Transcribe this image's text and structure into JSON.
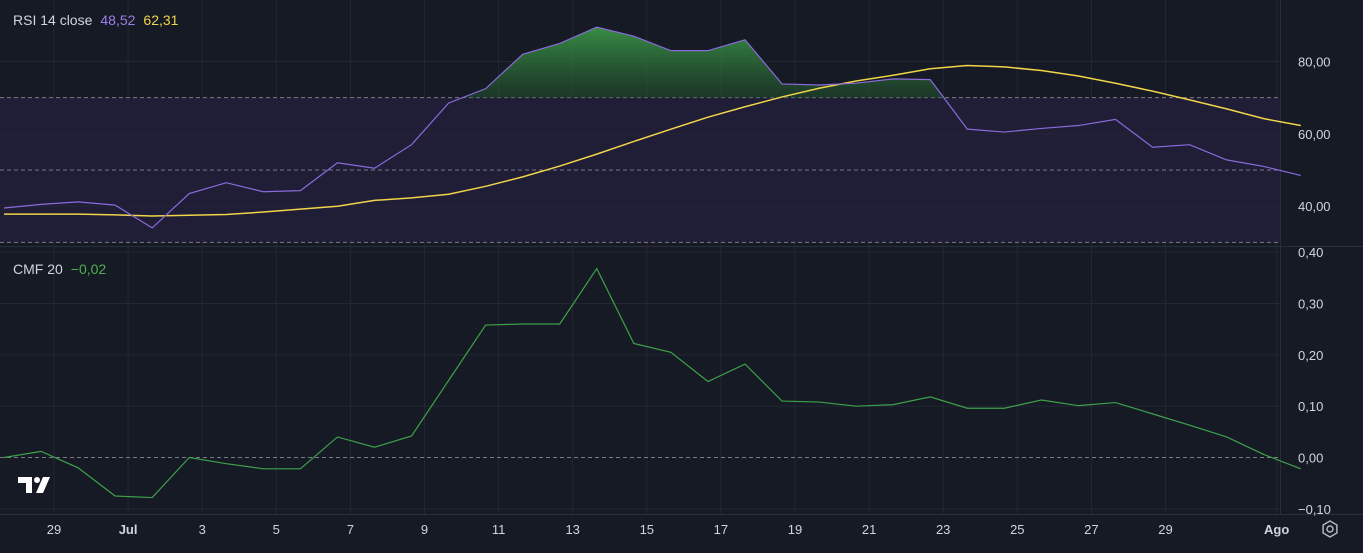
{
  "colors": {
    "background": "#161a25",
    "grid": "#232733",
    "rsi_line": "#8a6bdc",
    "rsi_ma_line": "#f0d44a",
    "cmf_line": "#3ea14a",
    "band_fill": "#221e3a",
    "overbought_fill": "#2f7d3a",
    "text": "#d1d4dc"
  },
  "icons": {
    "logo": "tradingview-logo-icon",
    "settings": "settings-gear-icon"
  },
  "rsi_legend": {
    "title": "RSI 14 close",
    "rsi_value": "48,52",
    "ma_value": "62,31"
  },
  "cmf_legend": {
    "title": "CMF 20",
    "value": "−0,02"
  },
  "chart_data": [
    {
      "type": "line",
      "title": "RSI 14 close",
      "x": [
        0,
        1,
        2,
        3,
        4,
        5,
        6,
        7,
        8,
        9,
        10,
        11,
        12,
        13,
        14,
        15,
        16,
        17,
        18,
        19,
        20,
        21,
        22,
        23,
        24,
        25,
        26,
        27,
        28,
        29,
        30,
        31,
        32,
        33,
        34,
        35,
        36,
        37,
        38,
        39
      ],
      "series": [
        {
          "name": "RSI",
          "values": [
            39.5,
            40.5,
            41.2,
            40.3,
            34,
            43.5,
            46.5,
            44,
            44.3,
            52,
            50.5,
            57,
            68.5,
            72.5,
            82,
            85,
            89.5,
            87,
            83,
            83,
            86,
            73.8,
            73.5,
            74,
            75.2,
            75,
            61.3,
            60.5,
            61.5,
            62.3,
            64,
            56.3,
            57,
            52.8,
            51,
            48.5
          ],
          "note_x_start": 0
        },
        {
          "name": "RSI MA",
          "values": [
            37.8,
            37.8,
            37.8,
            37.6,
            37.3,
            37.5,
            37.7,
            38.4,
            39.2,
            40,
            41.6,
            42.3,
            43.3,
            45.5,
            48.1,
            51.1,
            54.4,
            57.9,
            61.3,
            64.6,
            67.5,
            70.2,
            72.6,
            74.6,
            76.2,
            78,
            78.9,
            78.5,
            77.5,
            76,
            74,
            71.8,
            69.4,
            66.9,
            64.2,
            62.3
          ]
        }
      ],
      "yticks": [
        "40,00",
        "60,00",
        "80,00"
      ],
      "ylim": [
        29,
        97
      ],
      "bands": {
        "lower": 30,
        "middle": 50,
        "upper": 70
      }
    },
    {
      "type": "line",
      "title": "CMF 20",
      "series": [
        {
          "name": "CMF",
          "values": [
            0.0,
            0.012,
            -0.02,
            -0.075,
            -0.078,
            0.0,
            -0.012,
            -0.022,
            -0.022,
            0.04,
            0.02,
            0.042,
            0.15,
            0.258,
            0.26,
            0.26,
            0.368,
            0.222,
            0.205,
            0.148,
            0.182,
            0.11,
            0.108,
            0.1,
            0.103,
            0.118,
            0.096,
            0.096,
            0.112,
            0.101,
            0.107,
            0.085,
            0.063,
            0.04,
            0.006,
            -0.022
          ]
        }
      ],
      "yticks": [
        "0,40",
        "0,30",
        "0,20",
        "0,10",
        "0,00",
        "−0,10"
      ],
      "ylim": [
        -0.11,
        0.41
      ],
      "zero_line": 0
    }
  ],
  "x_axis": {
    "labels": [
      "29",
      "Jul",
      "3",
      "5",
      "7",
      "9",
      "11",
      "13",
      "15",
      "17",
      "19",
      "21",
      "23",
      "25",
      "27",
      "29",
      "Ago"
    ],
    "label_index": [
      0,
      2,
      4,
      6,
      8,
      10,
      12,
      14,
      16,
      18,
      20,
      22,
      24,
      26,
      28,
      30,
      33
    ]
  }
}
